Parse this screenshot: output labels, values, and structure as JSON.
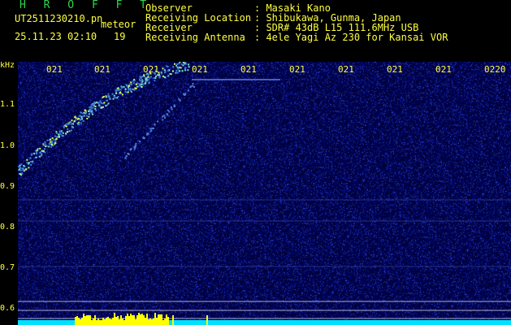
{
  "header": {
    "brand": "H R O F F T",
    "filename": "UT2511230210.pn",
    "file_type": "meteor",
    "datetime": "25.11.23 02:10",
    "count": "19",
    "observer_label": "Observer",
    "observer_value": ": Masaki Kano",
    "location_label": "Receiving Location",
    "location_value": ": Shibukawa, Gunma, Japan",
    "receiver_label": "Receiver",
    "receiver_value": ": SDR# 43dB L15 111.6MHz USB",
    "antenna_label": "Receiving Antenna",
    "antenna_value": ": 4ele Yagi Az 230 for Kansai VOR"
  },
  "axis": {
    "unit": "kHz",
    "y_labels": [
      "1.1",
      "1.0",
      "0.9",
      "0.8",
      "0.7",
      "0.6"
    ],
    "x_labels": [
      "021",
      "021",
      "021",
      "021",
      "021",
      "021",
      "021",
      "021",
      "021",
      "0220"
    ]
  },
  "colors": {
    "background": "#00003a",
    "text": "#ffff40",
    "brand": "#2bd84f",
    "trace": "#7fe0c0",
    "power": "#ffff00",
    "baseline": "#00e0ff"
  }
}
